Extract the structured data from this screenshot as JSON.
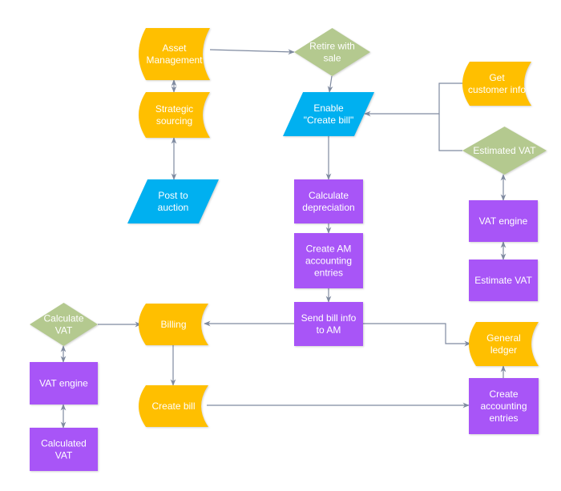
{
  "colors": {
    "document": "#ffbf00",
    "data": "#00b0f0",
    "process": "#a855f7",
    "decision": "#b4c98f",
    "edge": "#7f8aa0",
    "text": "#ffffff"
  },
  "nodes": [
    {
      "id": "asset-management",
      "type": "document",
      "lines": [
        "Asset",
        "Management"
      ]
    },
    {
      "id": "strategic-sourcing",
      "type": "document",
      "lines": [
        "Strategic",
        "sourcing"
      ]
    },
    {
      "id": "post-to-auction",
      "type": "data",
      "lines": [
        "Post to",
        "auction"
      ]
    },
    {
      "id": "retire-with-sale",
      "type": "decision",
      "lines": [
        "Retire with",
        "sale"
      ]
    },
    {
      "id": "enable-create-bill",
      "type": "data",
      "lines": [
        "Enable",
        "\"Create bill\""
      ]
    },
    {
      "id": "calculate-depreciation",
      "type": "process",
      "lines": [
        "Calculate",
        "depreciation"
      ]
    },
    {
      "id": "create-am-accounting-entries",
      "type": "process",
      "lines": [
        "Create AM",
        "accounting",
        "entries"
      ]
    },
    {
      "id": "send-bill-info-to-am",
      "type": "process",
      "lines": [
        "Send bill info",
        "to AM"
      ]
    },
    {
      "id": "get-customer-info",
      "type": "document",
      "lines": [
        "Get",
        "customer info"
      ]
    },
    {
      "id": "estimated-vat",
      "type": "decision",
      "lines": [
        "Estimated VAT"
      ]
    },
    {
      "id": "vat-engine-right",
      "type": "process",
      "lines": [
        "VAT engine"
      ]
    },
    {
      "id": "estimate-vat",
      "type": "process",
      "lines": [
        "Estimate VAT"
      ]
    },
    {
      "id": "general-ledger",
      "type": "document",
      "lines": [
        "General",
        "ledger"
      ]
    },
    {
      "id": "create-accounting-entries",
      "type": "process",
      "lines": [
        "Create",
        "accounting",
        "entries"
      ]
    },
    {
      "id": "calculate-vat",
      "type": "decision",
      "lines": [
        "Calculate",
        "VAT"
      ]
    },
    {
      "id": "billing",
      "type": "document",
      "lines": [
        "Billing"
      ]
    },
    {
      "id": "create-bill",
      "type": "document",
      "lines": [
        "Create bill"
      ]
    },
    {
      "id": "vat-engine-left",
      "type": "process",
      "lines": [
        "VAT engine"
      ]
    },
    {
      "id": "calculated-vat",
      "type": "process",
      "lines": [
        "Calculated",
        "VAT"
      ]
    }
  ],
  "edges": [
    {
      "from": "asset-management",
      "to": "retire-with-sale",
      "direction": "forward"
    },
    {
      "from": "asset-management",
      "to": "strategic-sourcing",
      "direction": "both"
    },
    {
      "from": "strategic-sourcing",
      "to": "post-to-auction",
      "direction": "both"
    },
    {
      "from": "retire-with-sale",
      "to": "enable-create-bill",
      "direction": "forward"
    },
    {
      "from": "get-customer-info",
      "to": "enable-create-bill",
      "direction": "forward"
    },
    {
      "from": "estimated-vat",
      "to": "enable-create-bill",
      "direction": "forward"
    },
    {
      "from": "enable-create-bill",
      "to": "calculate-depreciation",
      "direction": "forward"
    },
    {
      "from": "calculate-depreciation",
      "to": "create-am-accounting-entries",
      "direction": "forward"
    },
    {
      "from": "create-am-accounting-entries",
      "to": "send-bill-info-to-am",
      "direction": "forward"
    },
    {
      "from": "send-bill-info-to-am",
      "to": "billing",
      "direction": "forward"
    },
    {
      "from": "send-bill-info-to-am",
      "to": "general-ledger",
      "direction": "forward"
    },
    {
      "from": "estimated-vat",
      "to": "vat-engine-right",
      "direction": "both"
    },
    {
      "from": "vat-engine-right",
      "to": "estimate-vat",
      "direction": "both"
    },
    {
      "from": "create-accounting-entries",
      "to": "general-ledger",
      "direction": "forward"
    },
    {
      "from": "calculate-vat",
      "to": "billing",
      "direction": "forward"
    },
    {
      "from": "calculate-vat",
      "to": "vat-engine-left",
      "direction": "both"
    },
    {
      "from": "vat-engine-left",
      "to": "calculated-vat",
      "direction": "both"
    },
    {
      "from": "billing",
      "to": "create-bill",
      "direction": "forward"
    },
    {
      "from": "create-bill",
      "to": "create-accounting-entries",
      "direction": "forward"
    }
  ]
}
